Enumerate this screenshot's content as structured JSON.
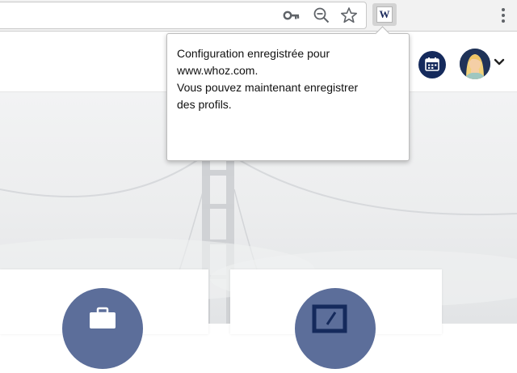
{
  "browser": {
    "toolbar_icons": [
      "key-icon",
      "zoom-out-icon",
      "bookmark-star-icon",
      "whoz-extension-icon",
      "browser-menu-icon"
    ],
    "extension_letter": "W"
  },
  "popup": {
    "lines": [
      "Configuration enregistrée pour",
      "www.whoz.com.",
      "Vous pouvez maintenant enregistrer",
      "des profils."
    ]
  },
  "header": {
    "icons": [
      "calendar-icon",
      "avatar",
      "chevron-down-icon"
    ]
  },
  "colors": {
    "navy": "#152a5c",
    "card_circle": "#5c6e9a",
    "toolbar": "#f2f2f2"
  }
}
